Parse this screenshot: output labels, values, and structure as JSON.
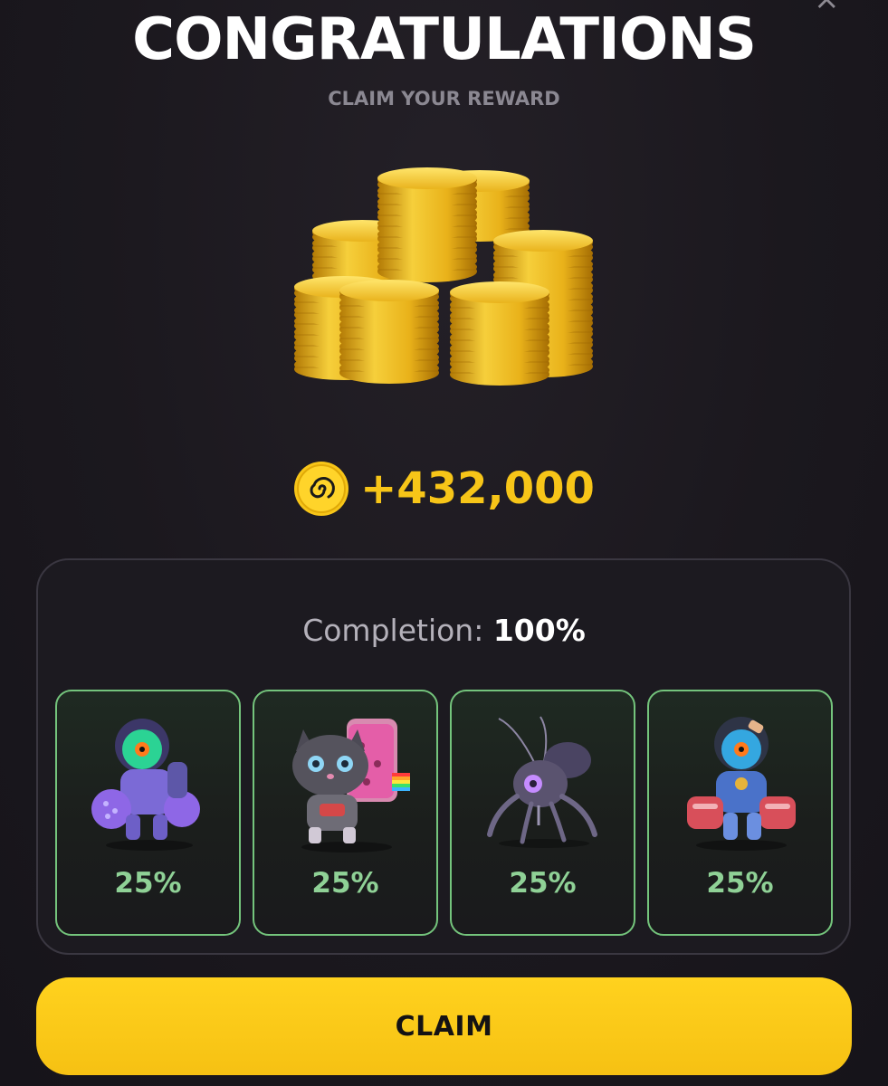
{
  "header": {
    "title": "CONGRATULATIONS",
    "subtitle": "CLAIM YOUR REWARD",
    "close_glyph": "×"
  },
  "reward": {
    "image": "gold-coin-stacks",
    "token_icon": "spiral-coin-icon",
    "amount": "+432,000"
  },
  "completion": {
    "label": "Completion:",
    "value": "100%"
  },
  "cards": [
    {
      "name": "purple-robot-astronaut",
      "percent": "25%"
    },
    {
      "name": "robot-cat-toast",
      "percent": "25%"
    },
    {
      "name": "robot-insect",
      "percent": "25%"
    },
    {
      "name": "blue-robot-astronaut",
      "percent": "25%"
    }
  ],
  "claim_button": {
    "label": "CLAIM"
  },
  "colors": {
    "background": "#1b181e",
    "accent_yellow": "#f7c518",
    "card_border_green": "#74c47c",
    "percent_green": "#8fd196",
    "muted_text": "#8b8892"
  }
}
